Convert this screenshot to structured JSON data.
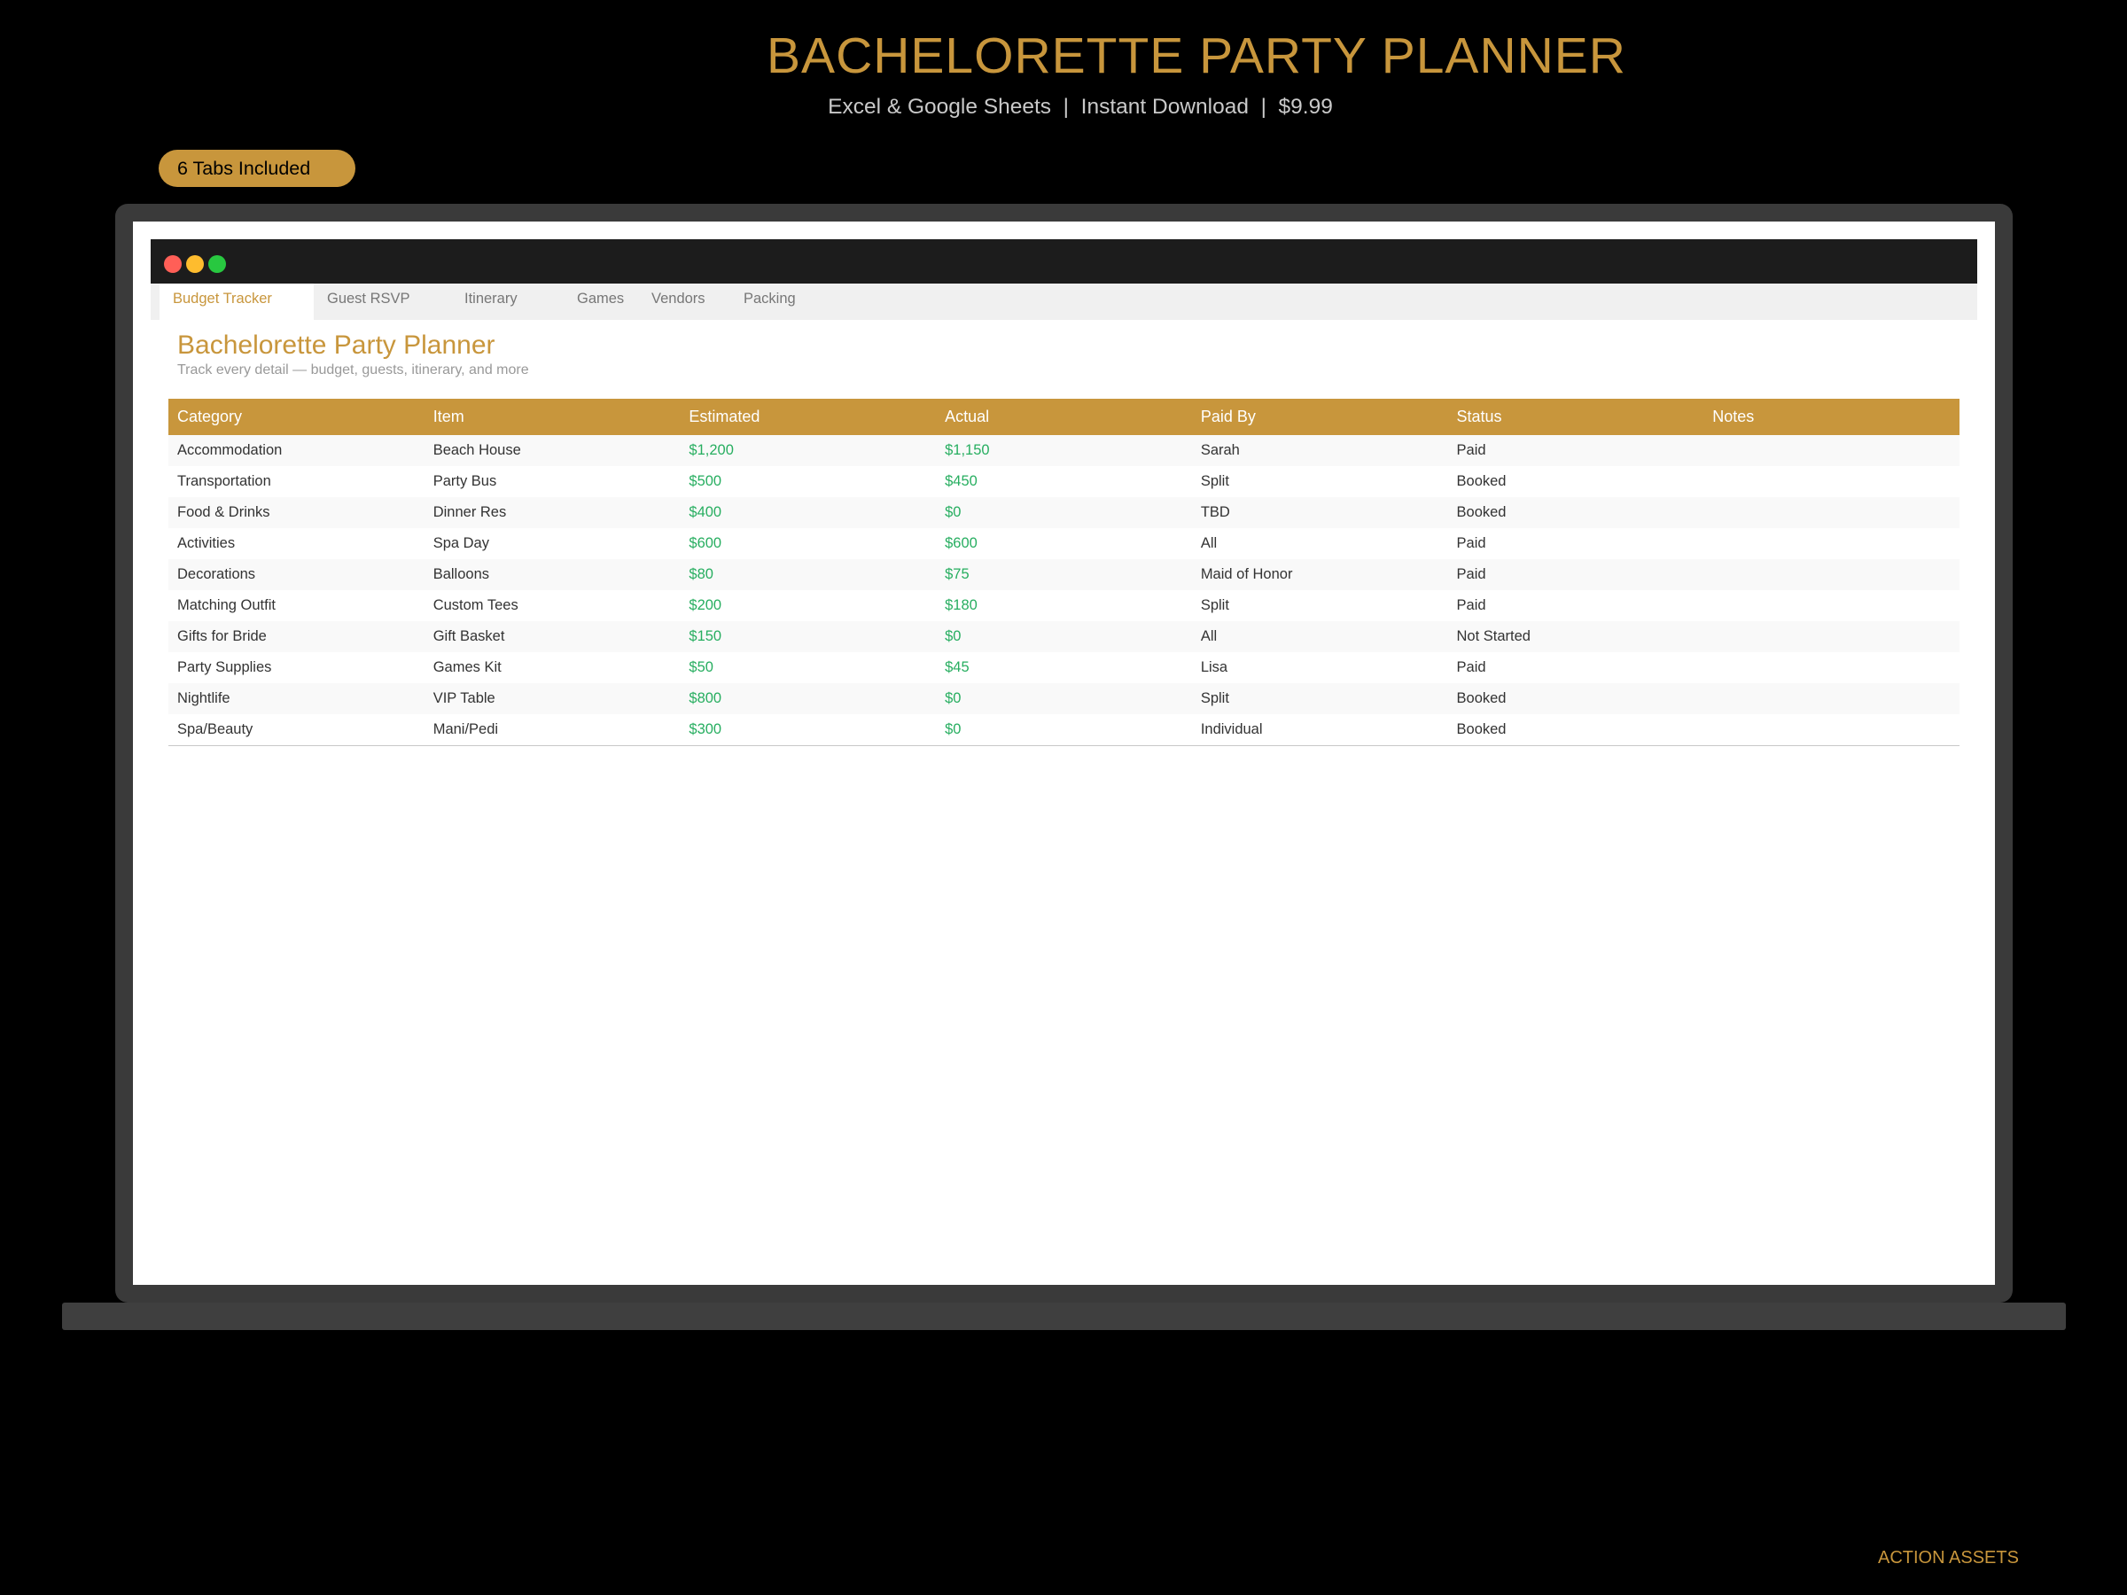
{
  "header": {
    "title": "BACHELORETTE PARTY PLANNER",
    "subtitle": "Excel & Google Sheets  |  Instant Download  |  $9.99"
  },
  "badge": {
    "label": "6 Tabs Included"
  },
  "app": {
    "tabs": [
      {
        "label": "Budget Tracker",
        "active": true
      },
      {
        "label": "Guest RSVP",
        "active": false
      },
      {
        "label": "Itinerary",
        "active": false
      },
      {
        "label": "Games",
        "active": false
      },
      {
        "label": "Vendors",
        "active": false
      },
      {
        "label": "Packing",
        "active": false
      }
    ],
    "title": "Bachelorette Party Planner",
    "subtitle": "Track every detail — budget, guests, itinerary, and more"
  },
  "table": {
    "columns": [
      "Category",
      "Item",
      "Estimated",
      "Actual",
      "Paid By",
      "Status",
      "Notes"
    ],
    "rows": [
      [
        "Accommodation",
        "Beach House",
        "$1,200",
        "$1,150",
        "Sarah",
        "Paid",
        ""
      ],
      [
        "Transportation",
        "Party Bus",
        "$500",
        "$450",
        "Split",
        "Booked",
        ""
      ],
      [
        "Food & Drinks",
        "Dinner Res",
        "$400",
        "$0",
        "TBD",
        "Booked",
        ""
      ],
      [
        "Activities",
        "Spa Day",
        "$600",
        "$600",
        "All",
        "Paid",
        ""
      ],
      [
        "Decorations",
        "Balloons",
        "$80",
        "$75",
        "Maid of Honor",
        "Paid",
        ""
      ],
      [
        "Matching Outfit",
        "Custom Tees",
        "$200",
        "$180",
        "Split",
        "Paid",
        ""
      ],
      [
        "Gifts for Bride",
        "Gift Basket",
        "$150",
        "$0",
        "All",
        "Not Started",
        ""
      ],
      [
        "Party Supplies",
        "Games Kit",
        "$50",
        "$45",
        "Lisa",
        "Paid",
        ""
      ],
      [
        "Nightlife",
        "VIP Table",
        "$800",
        "$0",
        "Split",
        "Booked",
        ""
      ],
      [
        "Spa/Beauty",
        "Mani/Pedi",
        "$300",
        "$0",
        "Individual",
        "Booked",
        ""
      ]
    ]
  },
  "footer": {
    "brand": "ACTION ASSETS"
  },
  "colors": {
    "accent": "#c8963c",
    "money": "#27ae60",
    "background": "#000000",
    "laptop_frame": "#3a3a3a"
  }
}
